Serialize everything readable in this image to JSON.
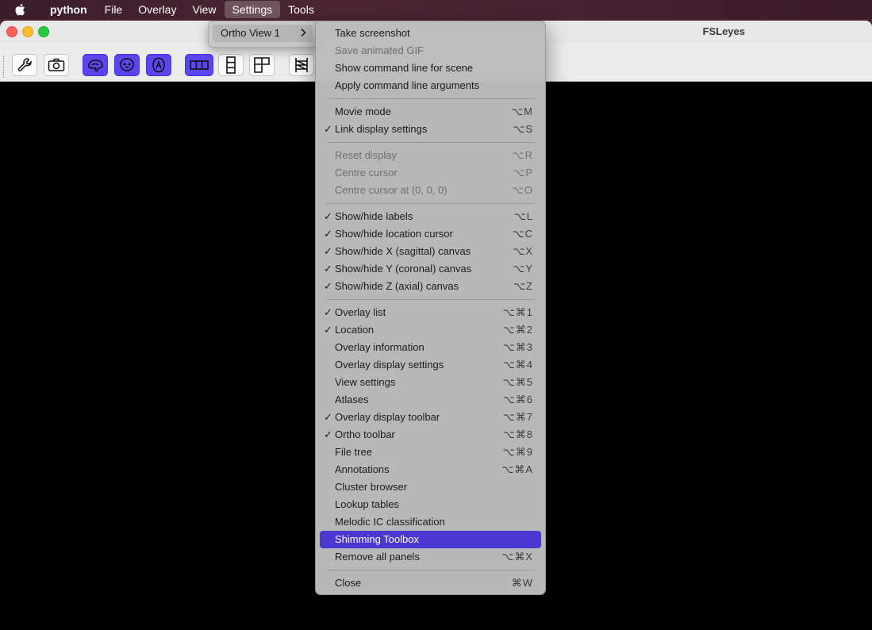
{
  "menubar": {
    "app_name": "python",
    "items": [
      "File",
      "Overlay",
      "View",
      "Settings",
      "Tools"
    ],
    "active_item": "Settings"
  },
  "window": {
    "title": "FSLeyes"
  },
  "toolbar": {
    "buttons": [
      {
        "icon": "wrench-icon",
        "state": "off"
      },
      {
        "icon": "camera-icon",
        "state": "off"
      },
      {
        "icon": "brain-sagittal-icon",
        "state": "on"
      },
      {
        "icon": "brain-coronal-icon",
        "state": "on"
      },
      {
        "icon": "brain-axial-icon",
        "state": "on"
      },
      {
        "icon": "layout-horizontal-icon",
        "state": "on"
      },
      {
        "icon": "layout-vertical-icon",
        "state": "off"
      },
      {
        "icon": "layout-grid-icon",
        "state": "off"
      },
      {
        "icon": "movie-icon",
        "state": "off"
      }
    ]
  },
  "submenu": {
    "label": "Ortho View 1",
    "chevron": "›"
  },
  "dropdown": {
    "sections": [
      [
        {
          "label": "Take screenshot",
          "shortcut": "",
          "checked": false,
          "enabled": true
        },
        {
          "label": "Save animated GIF",
          "shortcut": "",
          "checked": false,
          "enabled": false
        },
        {
          "label": "Show command line for scene",
          "shortcut": "",
          "checked": false,
          "enabled": true
        },
        {
          "label": "Apply command line arguments",
          "shortcut": "",
          "checked": false,
          "enabled": true
        }
      ],
      [
        {
          "label": "Movie mode",
          "shortcut": "⌥M",
          "checked": false,
          "enabled": true
        },
        {
          "label": "Link display settings",
          "shortcut": "⌥S",
          "checked": true,
          "enabled": true
        }
      ],
      [
        {
          "label": "Reset display",
          "shortcut": "⌥R",
          "checked": false,
          "enabled": false
        },
        {
          "label": "Centre cursor",
          "shortcut": "⌥P",
          "checked": false,
          "enabled": false
        },
        {
          "label": "Centre cursor at (0, 0, 0)",
          "shortcut": "⌥O",
          "checked": false,
          "enabled": false
        }
      ],
      [
        {
          "label": "Show/hide labels",
          "shortcut": "⌥L",
          "checked": true,
          "enabled": true
        },
        {
          "label": "Show/hide location cursor",
          "shortcut": "⌥C",
          "checked": true,
          "enabled": true
        },
        {
          "label": "Show/hide X (sagittal) canvas",
          "shortcut": "⌥X",
          "checked": true,
          "enabled": true
        },
        {
          "label": "Show/hide Y (coronal) canvas",
          "shortcut": "⌥Y",
          "checked": true,
          "enabled": true
        },
        {
          "label": "Show/hide Z (axial) canvas",
          "shortcut": "⌥Z",
          "checked": true,
          "enabled": true
        }
      ],
      [
        {
          "label": "Overlay list",
          "shortcut": "⌥⌘1",
          "checked": true,
          "enabled": true
        },
        {
          "label": "Location",
          "shortcut": "⌥⌘2",
          "checked": true,
          "enabled": true
        },
        {
          "label": "Overlay information",
          "shortcut": "⌥⌘3",
          "checked": false,
          "enabled": true
        },
        {
          "label": "Overlay display settings",
          "shortcut": "⌥⌘4",
          "checked": false,
          "enabled": true
        },
        {
          "label": "View settings",
          "shortcut": "⌥⌘5",
          "checked": false,
          "enabled": true
        },
        {
          "label": "Atlases",
          "shortcut": "⌥⌘6",
          "checked": false,
          "enabled": true
        },
        {
          "label": "Overlay display toolbar",
          "shortcut": "⌥⌘7",
          "checked": true,
          "enabled": true
        },
        {
          "label": "Ortho toolbar",
          "shortcut": "⌥⌘8",
          "checked": true,
          "enabled": true
        },
        {
          "label": "File tree",
          "shortcut": "⌥⌘9",
          "checked": false,
          "enabled": true
        },
        {
          "label": "Annotations",
          "shortcut": "⌥⌘A",
          "checked": false,
          "enabled": true
        },
        {
          "label": "Cluster browser",
          "shortcut": "",
          "checked": false,
          "enabled": true
        },
        {
          "label": "Lookup tables",
          "shortcut": "",
          "checked": false,
          "enabled": true
        },
        {
          "label": "Melodic IC classification",
          "shortcut": "",
          "checked": false,
          "enabled": true
        },
        {
          "label": "Shimming Toolbox",
          "shortcut": "",
          "checked": false,
          "enabled": true,
          "highlighted": true
        },
        {
          "label": "Remove all panels",
          "shortcut": "⌥⌘X",
          "checked": false,
          "enabled": true
        }
      ],
      [
        {
          "label": "Close",
          "shortcut": "⌘W",
          "checked": false,
          "enabled": true
        }
      ]
    ],
    "check_glyph": "✓"
  },
  "colors": {
    "accent": "#5a46f0",
    "highlight": "#4a38d1",
    "canvas": "#000000"
  }
}
